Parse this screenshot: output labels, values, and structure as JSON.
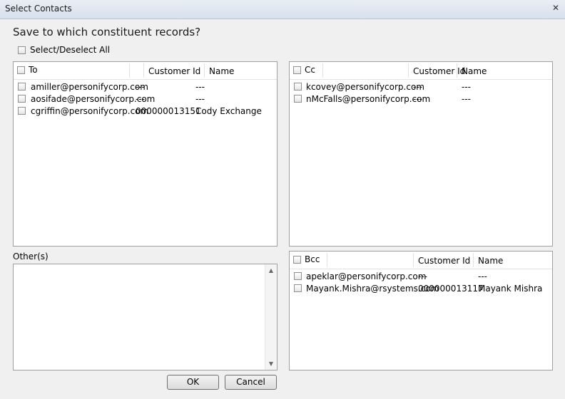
{
  "window": {
    "title": "Select Contacts",
    "close_glyph": "✕"
  },
  "prompt": "Save to which constituent records?",
  "select_all_label": "Select/Deselect All",
  "to": {
    "header": {
      "label": "To",
      "customer_id": "Customer Id",
      "name": "Name"
    },
    "rows": [
      {
        "email": "amiller@personifycorp.com",
        "customer_id": "---",
        "name": "---"
      },
      {
        "email": "aosifade@personifycorp.com",
        "customer_id": "---",
        "name": "---"
      },
      {
        "email": "cgriffin@personifycorp.com",
        "customer_id": "000000013151",
        "name": "Cody Exchange"
      }
    ]
  },
  "cc": {
    "header": {
      "label": "Cc",
      "customer_id": "Customer Id",
      "name": "Name"
    },
    "rows": [
      {
        "email": "kcovey@personifycorp.com",
        "customer_id": "---",
        "name": "---"
      },
      {
        "email": "nMcFalls@personifycorp.com",
        "customer_id": "---",
        "name": "---"
      }
    ]
  },
  "bcc": {
    "header": {
      "label": "Bcc",
      "customer_id": "Customer Id",
      "name": "Name"
    },
    "rows": [
      {
        "email": "apeklar@personifycorp.com",
        "customer_id": "---",
        "name": "---"
      },
      {
        "email": "Mayank.Mishra@rsystems.com",
        "customer_id": "000000013117",
        "name": "Mayank Mishra"
      }
    ]
  },
  "others": {
    "label": "Other(s)",
    "value": ""
  },
  "buttons": {
    "ok": "OK",
    "cancel": "Cancel"
  },
  "icons": {
    "scroll_up": "scroll-up-arrow-icon",
    "scroll_down": "scroll-down-arrow-icon"
  }
}
